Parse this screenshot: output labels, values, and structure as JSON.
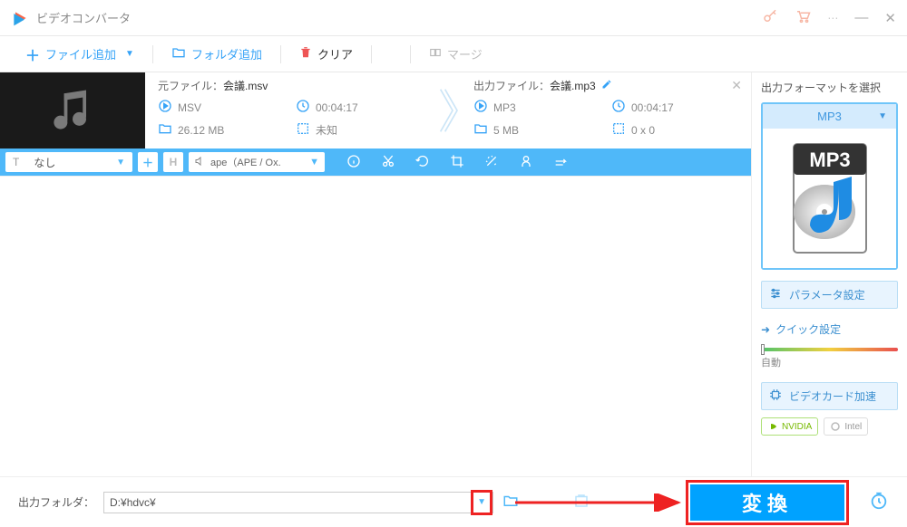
{
  "app": {
    "title": "ビデオコンバータ"
  },
  "toolbar": {
    "add_file": "ファイル追加",
    "add_folder": "フォルダ追加",
    "clear": "クリア",
    "merge": "マージ"
  },
  "file": {
    "src": {
      "header": "元ファイル：",
      "name": "会議.msv",
      "format": "MSV",
      "duration": "00:04:17",
      "size": "26.12 MB",
      "dim": "未知"
    },
    "out": {
      "header": "出力ファイル：",
      "name": "会議.mp3",
      "format": "MP3",
      "duration": "00:04:17",
      "size": "5 MB",
      "dim": "0 x 0"
    },
    "bar": {
      "tag": "なし",
      "ape": "ape（APE / Ox."
    }
  },
  "side": {
    "title": "出力フォーマットを選択",
    "format": "MP3",
    "mp3_label": "MP3",
    "param": "パラメータ設定",
    "quick": "クイック設定",
    "auto": "自動",
    "hw": "ビデオカード加速",
    "nvidia": "NVIDIA",
    "intel": "Intel"
  },
  "footer": {
    "label": "出力フォルダ：",
    "path": "D:¥hdvc¥",
    "convert": "変換"
  }
}
